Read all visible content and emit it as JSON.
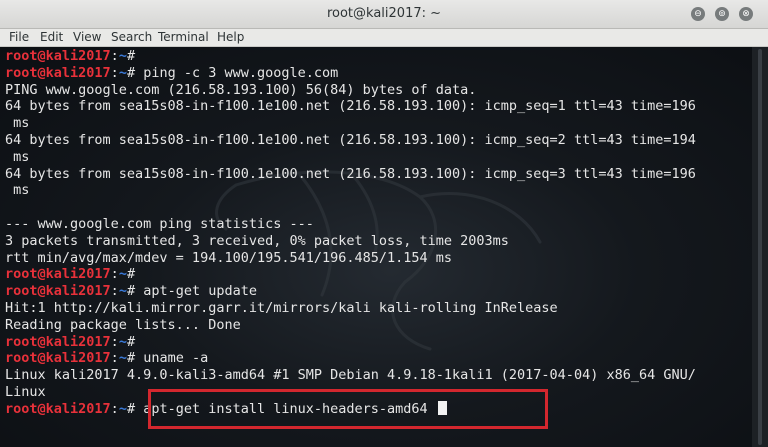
{
  "window": {
    "title": "root@kali2017: ~"
  },
  "controls": {
    "minimize": "⊖",
    "maximize": "⊚",
    "close": "⊗"
  },
  "menu": [
    "File",
    "Edit",
    "View",
    "Search",
    "Terminal",
    "Help"
  ],
  "prompt": {
    "user": "root@kali2017",
    "sep": ":",
    "path": "~",
    "sym": "# "
  },
  "terminal_lines": [
    {
      "prompt": true,
      "text": ""
    },
    {
      "prompt": true,
      "text": "ping -c 3 www.google.com"
    },
    {
      "text": "PING www.google.com (216.58.193.100) 56(84) bytes of data."
    },
    {
      "text": "64 bytes from sea15s08-in-f100.1e100.net (216.58.193.100): icmp_seq=1 ttl=43 time=196"
    },
    {
      "text": " ms"
    },
    {
      "text": "64 bytes from sea15s08-in-f100.1e100.net (216.58.193.100): icmp_seq=2 ttl=43 time=194"
    },
    {
      "text": " ms"
    },
    {
      "text": "64 bytes from sea15s08-in-f100.1e100.net (216.58.193.100): icmp_seq=3 ttl=43 time=196"
    },
    {
      "text": " ms"
    },
    {
      "text": ""
    },
    {
      "text": "--- www.google.com ping statistics ---"
    },
    {
      "text": "3 packets transmitted, 3 received, 0% packet loss, time 2003ms"
    },
    {
      "text": "rtt min/avg/max/mdev = 194.100/195.541/196.485/1.154 ms"
    },
    {
      "prompt": true,
      "text": ""
    },
    {
      "prompt": true,
      "text": "apt-get update"
    },
    {
      "text": "Hit:1 http://kali.mirror.garr.it/mirrors/kali kali-rolling InRelease"
    },
    {
      "text": "Reading package lists... Done"
    },
    {
      "prompt": true,
      "text": ""
    },
    {
      "prompt": true,
      "text": "uname -a"
    },
    {
      "text": "Linux kali2017 4.9.0-kali3-amd64 #1 SMP Debian 4.9.18-1kali1 (2017-04-04) x86_64 GNU/"
    },
    {
      "text": "Linux"
    },
    {
      "prompt": true,
      "text": "apt-get install linux-headers-amd64 ",
      "cursor": true
    }
  ],
  "colors": {
    "prompt_user": "#e8313a",
    "prompt_path": "#3b7ad8",
    "highlight_box": "#d3272e"
  }
}
